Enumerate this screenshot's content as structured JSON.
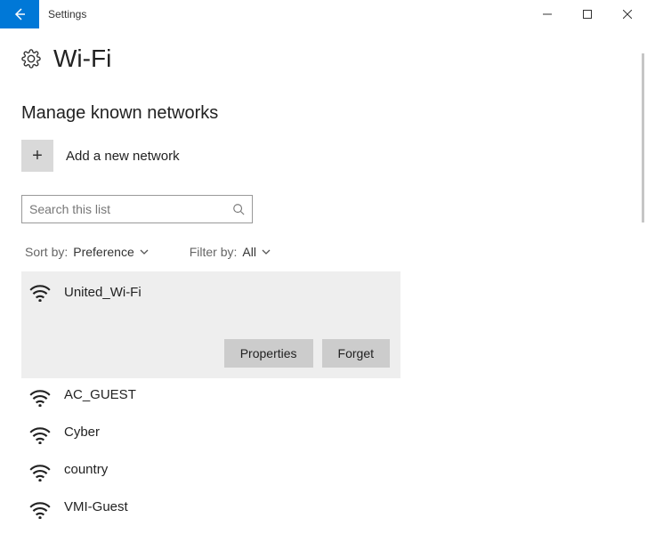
{
  "window": {
    "title": "Settings"
  },
  "page": {
    "title": "Wi-Fi",
    "subheading": "Manage known networks"
  },
  "add_network": {
    "label": "Add a new network"
  },
  "search": {
    "placeholder": "Search this list"
  },
  "sort": {
    "label": "Sort by:",
    "value": "Preference"
  },
  "filter": {
    "label": "Filter by:",
    "value": "All"
  },
  "selected_actions": {
    "properties": "Properties",
    "forget": "Forget"
  },
  "networks": [
    {
      "name": "United_Wi-Fi",
      "selected": true
    },
    {
      "name": "AC_GUEST",
      "selected": false
    },
    {
      "name": "Cyber",
      "selected": false
    },
    {
      "name": "country",
      "selected": false
    },
    {
      "name": "VMI-Guest",
      "selected": false
    }
  ]
}
